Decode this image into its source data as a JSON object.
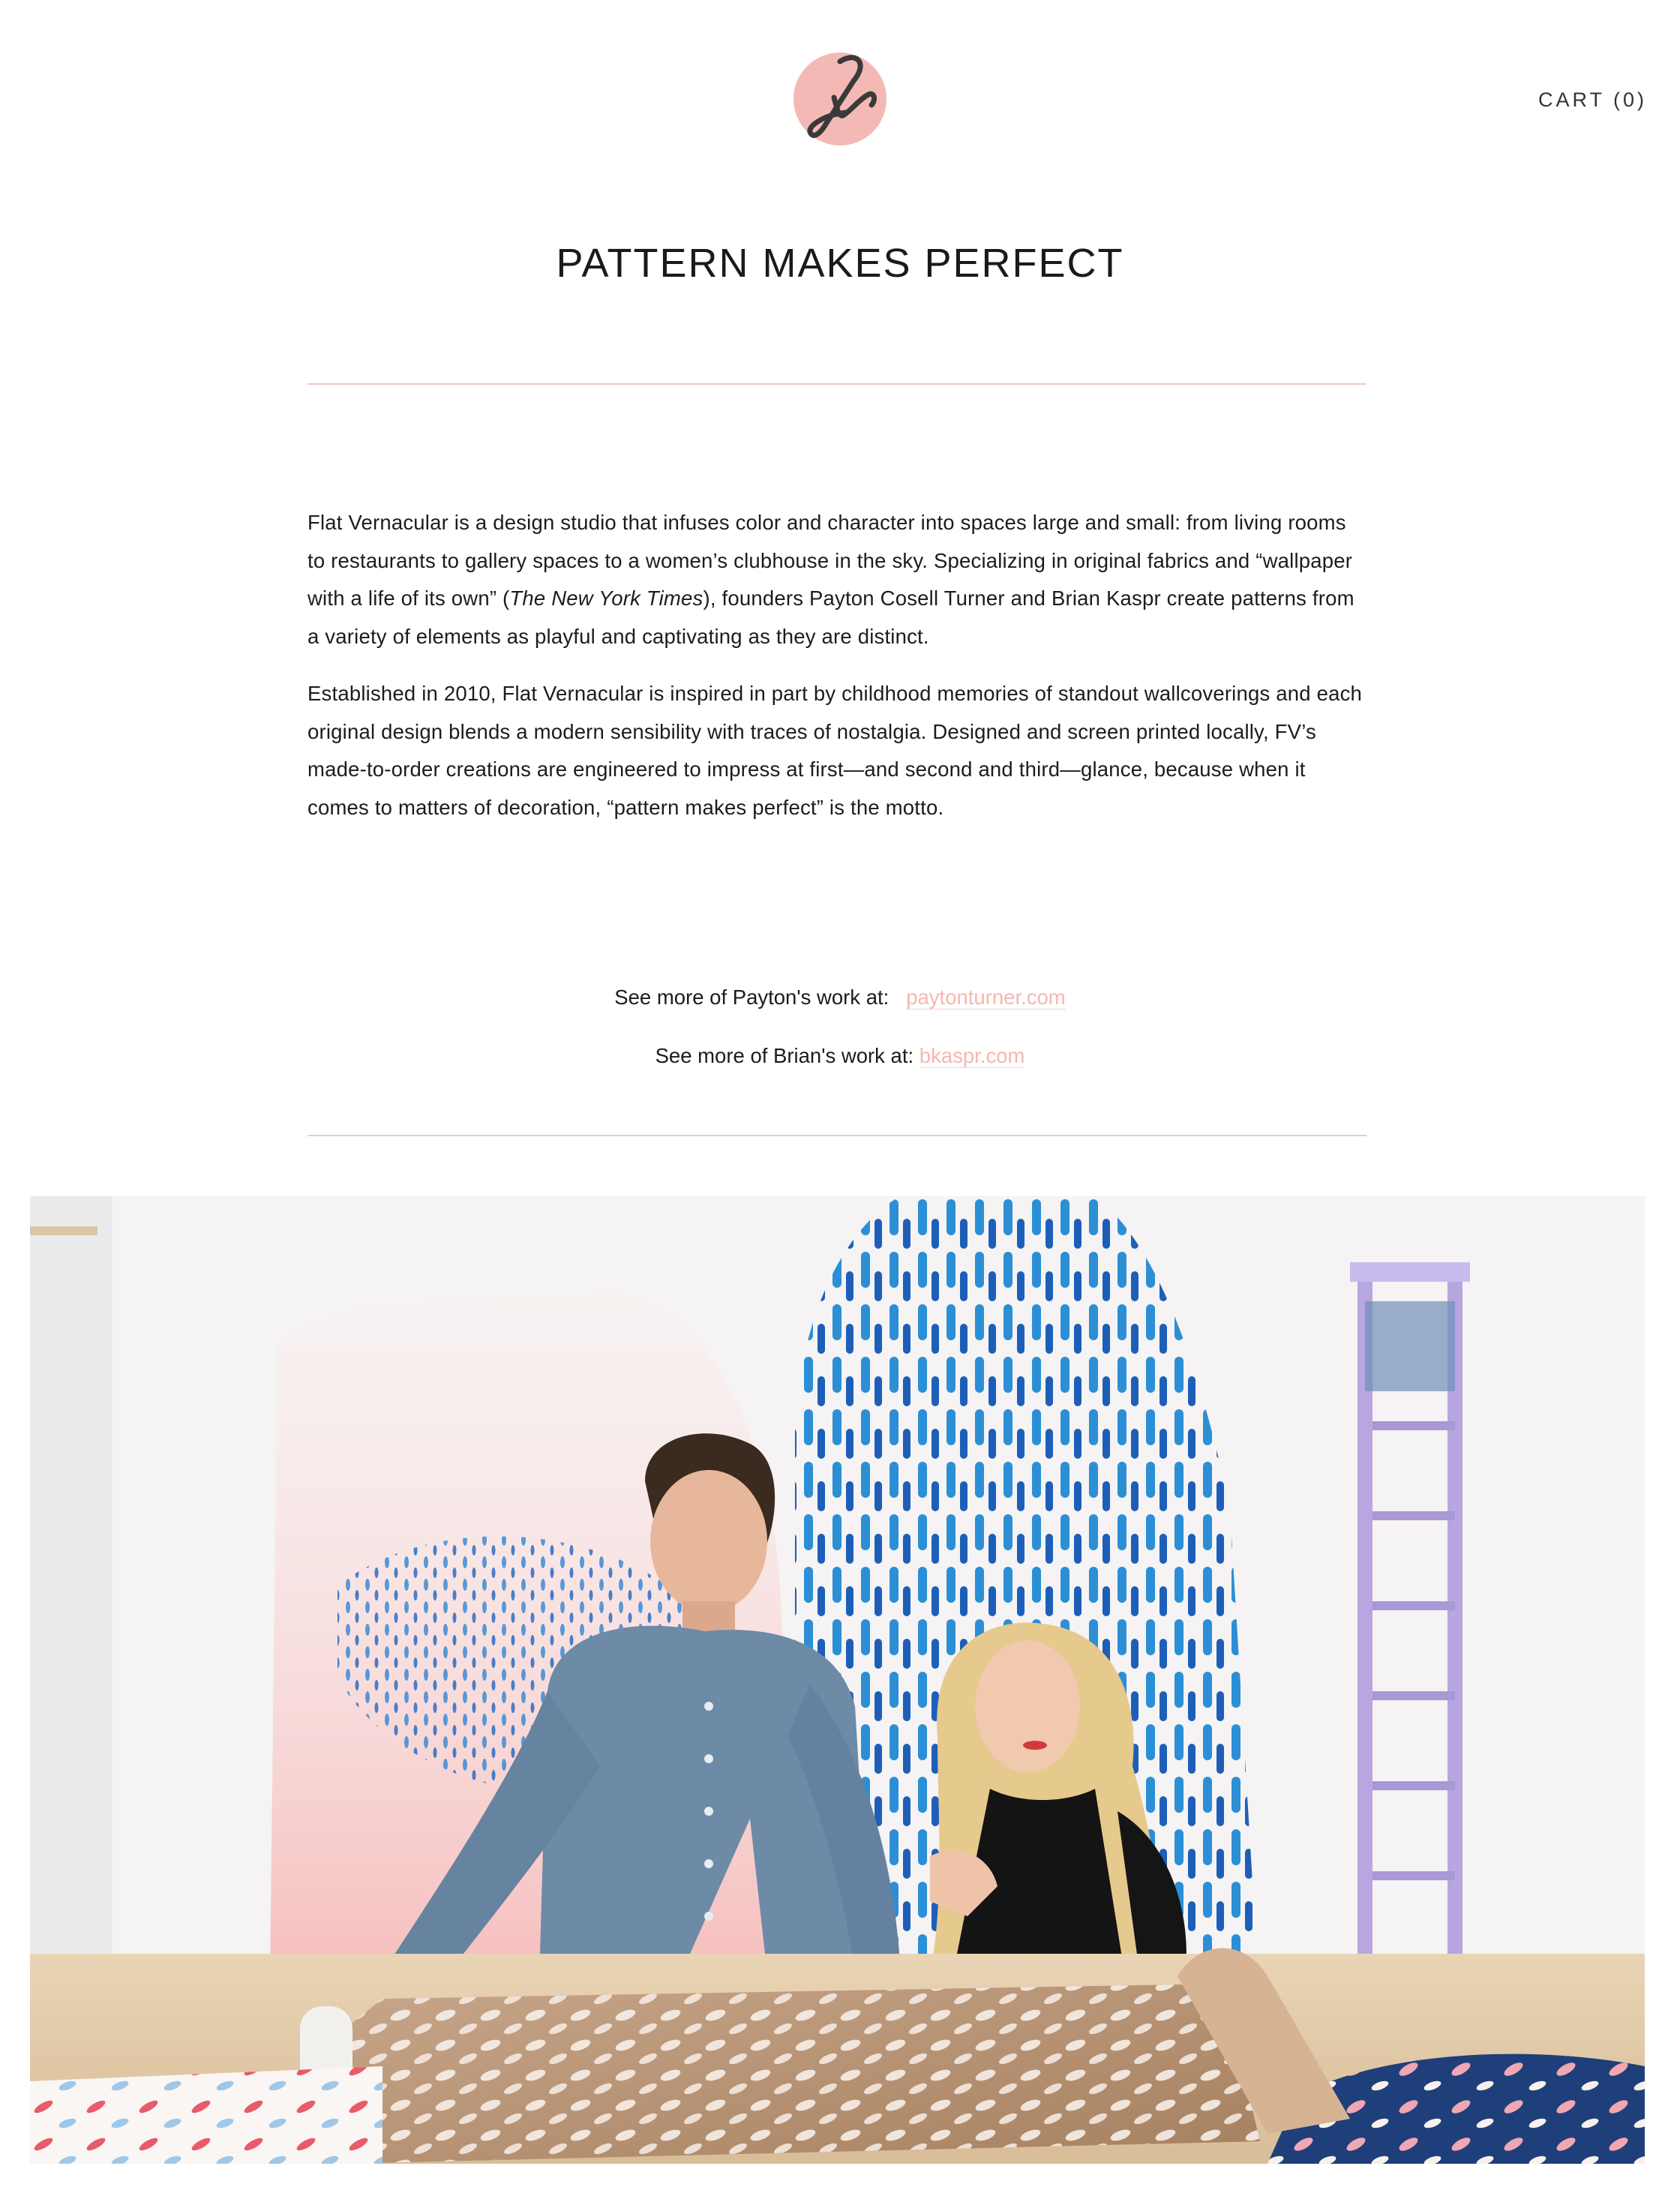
{
  "header": {
    "logo_text": "fv",
    "cart_label": "CART (0)"
  },
  "page": {
    "title": "PATTERN MAKES PERFECT"
  },
  "intro": {
    "p1_a": "Flat Vernacular is a design studio that infuses color and character into spaces large and small: from living rooms to restaurants to gallery spaces to a women’s clubhouse in the sky. Specializing in original fabrics and “wallpaper with a life of its own” (",
    "p1_em": "The New York Times",
    "p1_b": "), founders Payton Cosell Turner and Brian Kaspr create patterns from a variety of elements as playful and captivating as they are distinct.",
    "p2": "Established in 2010, Flat Vernacular is inspired in part by childhood memories of standout wallcoverings and each original design blends a modern sensibility with traces of nostalgia. Designed and screen printed locally, FV’s made-to-order creations are engineered to impress at first—and second and third—glance, because when it comes to matters of decoration, “pattern makes perfect” is the motto."
  },
  "links": {
    "payton_label": "See more of Payton's work at:",
    "payton_link": "paytonturner.com",
    "brian_label": "See more of Brian's work at:",
    "brian_link": "bkaspr.com"
  },
  "colors": {
    "accent_pink": "#f4b7b0",
    "rule_pink": "#f2c8c3",
    "logo_circle": "#f4b9b5",
    "text": "#1c1c1c"
  }
}
